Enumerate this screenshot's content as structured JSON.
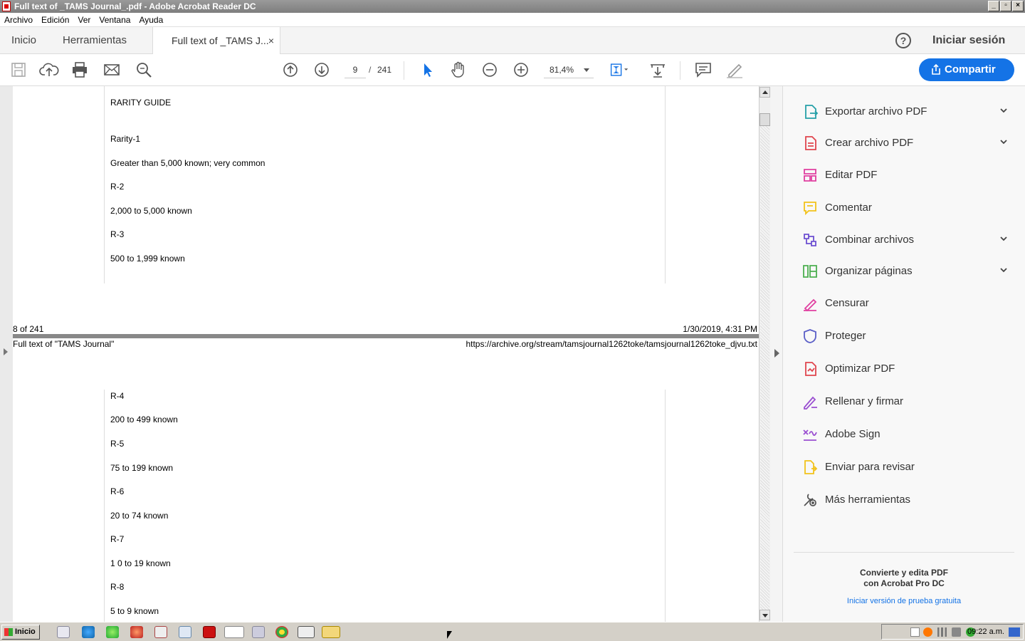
{
  "window": {
    "title": "Full text of _TAMS Journal_.pdf - Adobe Acrobat Reader DC",
    "min_label": "_",
    "max_label": "▫",
    "close_label": "×"
  },
  "menu": [
    "Archivo",
    "Edición",
    "Ver",
    "Ventana",
    "Ayuda"
  ],
  "tabs": {
    "home": "Inicio",
    "tools": "Herramientas",
    "document": "Full text of _TAMS J...",
    "close": "×"
  },
  "header": {
    "help": "?",
    "signin": "Iniciar sesión"
  },
  "toolbar": {
    "page_current": "9",
    "page_sep": "/",
    "page_total": "241",
    "zoom": "81,4%",
    "share": "Compartir"
  },
  "document": {
    "page1_lines": [
      "RARITY GUIDE",
      "Rarity-1",
      "Greater than 5,000 known; very common",
      "R-2",
      "2,000 to 5,000 known",
      "R-3",
      "500 to 1,999 known"
    ],
    "footer_left": "8 of 241",
    "footer_right": "1/30/2019, 4:31 PM",
    "header_left": "Full text of \"TAMS Journal\"",
    "header_right": "https://archive.org/stream/tamsjournal1262toke/tamsjournal1262toke_djvu.txt",
    "page2_lines": [
      "R-4",
      "200 to 499 known",
      "R-5",
      "75 to 199 known",
      "R-6",
      "20 to 74 known",
      "R-7",
      "1 0 to 19 known",
      "R-8",
      "5 to 9 known"
    ]
  },
  "tools_pane": {
    "items": [
      {
        "label": "Exportar archivo PDF",
        "icon": "export-pdf-icon",
        "color": "#26a0a8",
        "expandable": true
      },
      {
        "label": "Crear archivo PDF",
        "icon": "create-pdf-icon",
        "color": "#e0454e",
        "expandable": true
      },
      {
        "label": "Editar PDF",
        "icon": "edit-pdf-icon",
        "color": "#e03fa0",
        "expandable": false
      },
      {
        "label": "Comentar",
        "icon": "comment-icon",
        "color": "#f2c21b",
        "expandable": false
      },
      {
        "label": "Combinar archivos",
        "icon": "combine-files-icon",
        "color": "#6d4fd1",
        "expandable": true
      },
      {
        "label": "Organizar páginas",
        "icon": "organize-pages-icon",
        "color": "#4caf50",
        "expandable": true
      },
      {
        "label": "Censurar",
        "icon": "redact-icon",
        "color": "#e03fa0",
        "expandable": false
      },
      {
        "label": "Proteger",
        "icon": "protect-icon",
        "color": "#5b5fc7",
        "expandable": false
      },
      {
        "label": "Optimizar PDF",
        "icon": "optimize-pdf-icon",
        "color": "#e0454e",
        "expandable": false
      },
      {
        "label": "Rellenar y firmar",
        "icon": "fill-sign-icon",
        "color": "#9a4fd1",
        "expandable": false
      },
      {
        "label": "Adobe Sign",
        "icon": "adobe-sign-icon",
        "color": "#9a4fd1",
        "expandable": false
      },
      {
        "label": "Enviar para revisar",
        "icon": "send-review-icon",
        "color": "#f2c21b",
        "expandable": false
      },
      {
        "label": "Más herramientas",
        "icon": "more-tools-icon",
        "color": "#555555",
        "expandable": false
      }
    ],
    "promo_line1": "Convierte y edita PDF",
    "promo_line2": "con Acrobat Pro DC",
    "promo_link": "Iniciar versión de prueba gratuita"
  },
  "taskbar": {
    "start": "Inicio",
    "clock": "09:22 a.m."
  },
  "colors": {
    "accent": "#1473e6",
    "taskbar": "#d4d0c8"
  }
}
